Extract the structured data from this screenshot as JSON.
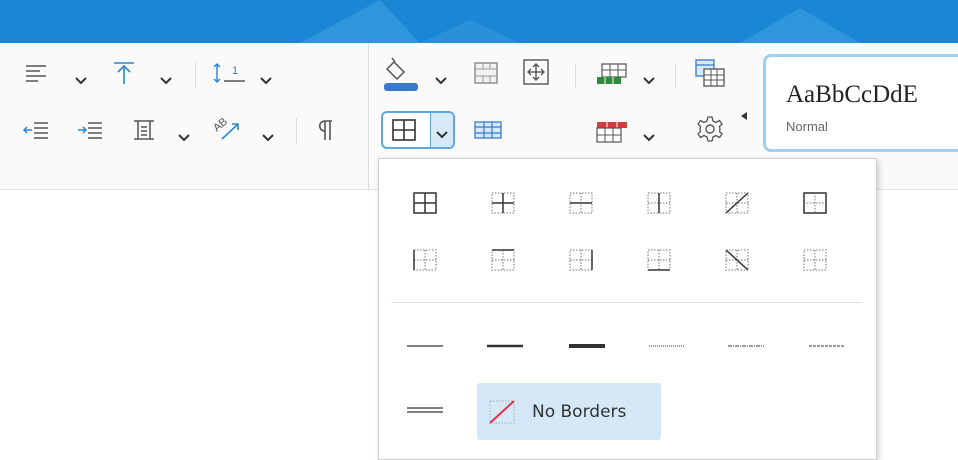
{
  "colors": {
    "title_bar": "#1a87d4",
    "accent": "#5aa8e6",
    "highlight": "#d4e8f8",
    "green": "#2e8b3a",
    "red": "#d23c3c",
    "no_border_slash": "#e0344a"
  },
  "ribbon": {
    "paragraph_group": {
      "row1": [
        "align-left-icon",
        "vertical-align-top-icon",
        "line-spacing-icon"
      ],
      "row2": [
        "decrease-indent-icon",
        "increase-indent-icon",
        "cell-margins-icon",
        "text-direction-icon",
        "paragraph-marks-icon"
      ]
    },
    "table_group": {
      "row1": [
        "fill-color-icon",
        "merge-cells-icon",
        "move-table-icon",
        "insert-rows-icon",
        "table-properties-icon"
      ],
      "row2": [
        "borders-icon",
        "table-grid-icon",
        "delete-rows-icon",
        "settings-icon"
      ]
    },
    "style_gallery": {
      "preview_text": "AaBbCcDdE",
      "style_name": "Normal"
    }
  },
  "borders_menu": {
    "border_presets": [
      "all-borders",
      "inner-borders",
      "inner-horizontal-border",
      "inner-vertical-border",
      "diagonal-up-border",
      "outside-borders",
      "left-border",
      "top-border",
      "right-border",
      "bottom-border",
      "diagonal-down-border",
      "no-inner-borders"
    ],
    "line_styles": [
      "thin",
      "medium",
      "thick",
      "dotted",
      "dash-dot",
      "dashed",
      "double"
    ],
    "no_borders_label": "No Borders"
  }
}
